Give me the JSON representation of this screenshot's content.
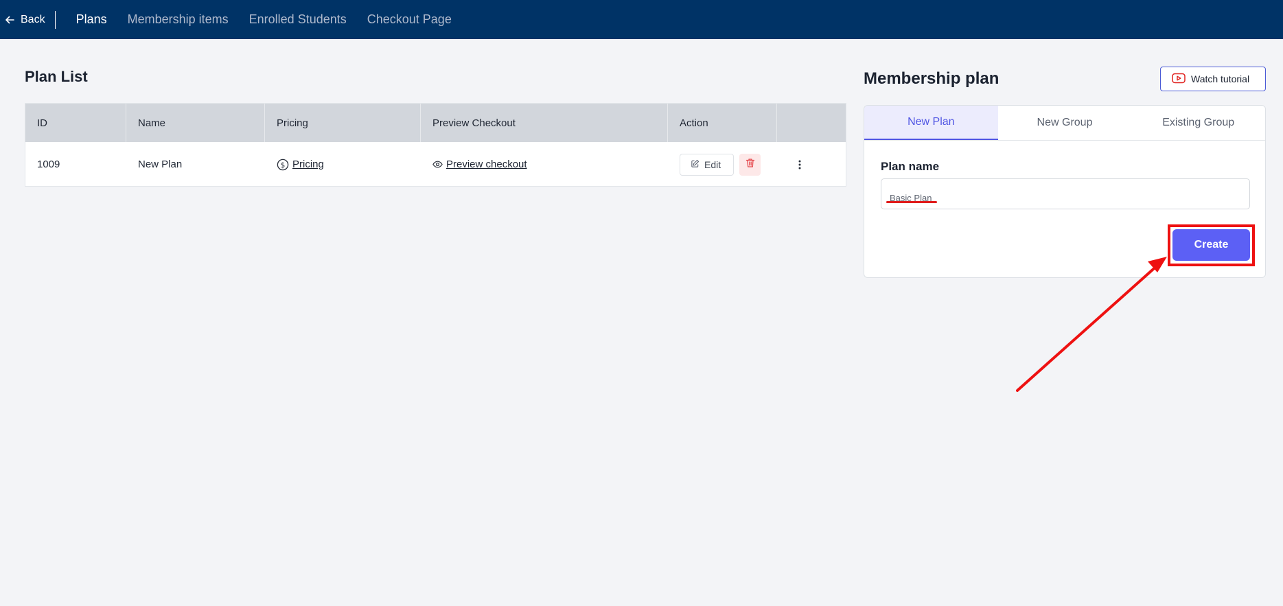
{
  "topnav": {
    "back_label": "Back",
    "tabs": [
      {
        "label": "Plans",
        "active": true
      },
      {
        "label": "Membership items",
        "active": false
      },
      {
        "label": "Enrolled Students",
        "active": false
      },
      {
        "label": "Checkout Page",
        "active": false
      }
    ]
  },
  "plan_list": {
    "title": "Plan List",
    "columns": [
      "ID",
      "Name",
      "Pricing",
      "Preview Checkout",
      "Action"
    ],
    "rows": [
      {
        "id": "1009",
        "name": "New Plan",
        "pricing_link": "Pricing",
        "preview_link": "Preview checkout",
        "edit_label": "Edit"
      }
    ]
  },
  "membership_plan": {
    "title": "Membership plan",
    "watch_tutorial_label": "Watch tutorial",
    "tabs": [
      {
        "label": "New Plan",
        "active": true
      },
      {
        "label": "New Group",
        "active": false
      },
      {
        "label": "Existing Group",
        "active": false
      }
    ],
    "plan_name_label": "Plan name",
    "plan_name_value": "Basic Plan",
    "create_label": "Create"
  },
  "colors": {
    "topbar": "#003366",
    "accent": "#5c60f5",
    "annotation": "#ee1111",
    "delete_bg": "#fde8e8"
  }
}
